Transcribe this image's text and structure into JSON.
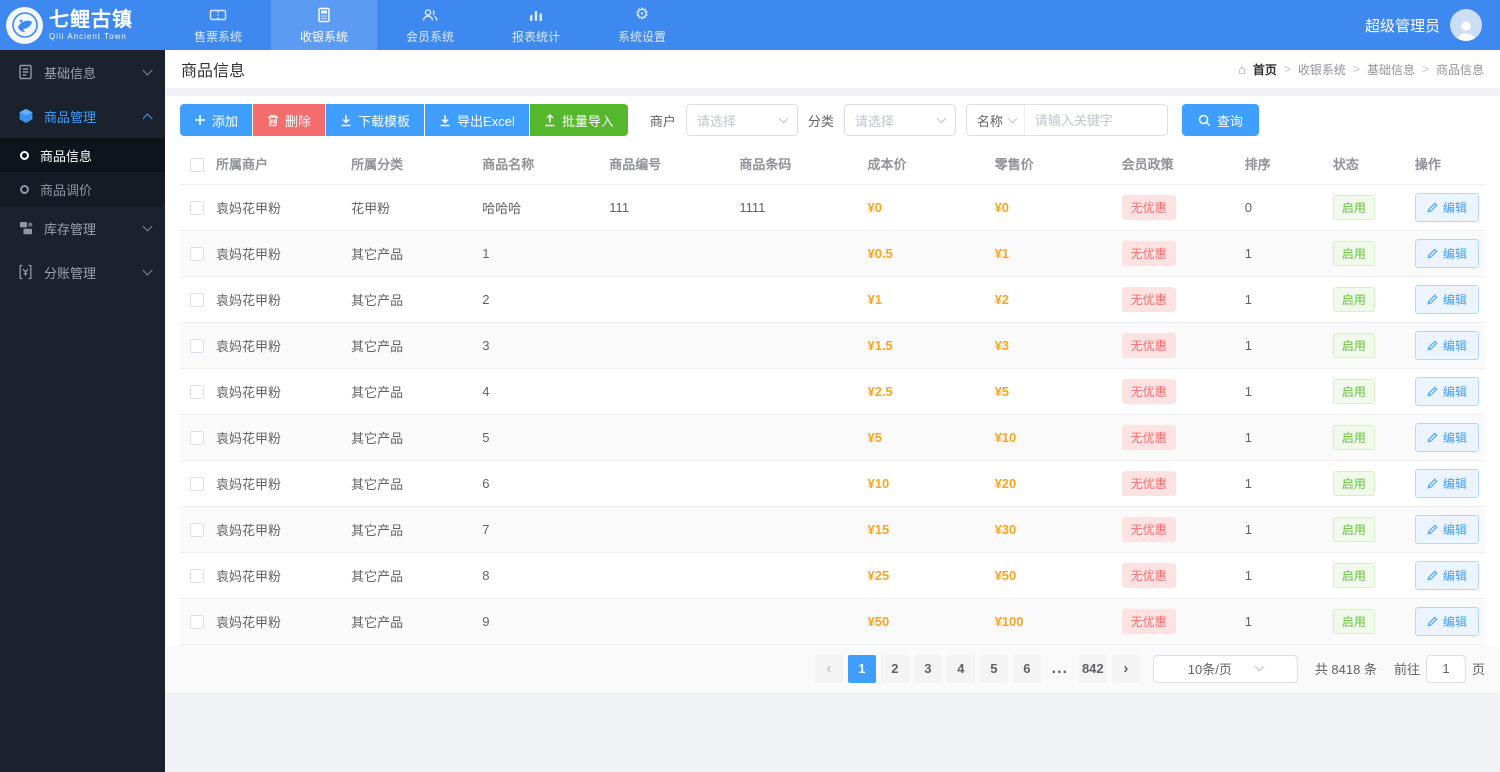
{
  "header": {
    "logo": {
      "title": "七鲤古镇",
      "subtitle": "Qili Ancient Town"
    },
    "nav": [
      {
        "label": "售票系统",
        "icon": "ticket-icon",
        "active": false
      },
      {
        "label": "收银系统",
        "icon": "pos-icon",
        "active": true
      },
      {
        "label": "会员系统",
        "icon": "members-icon",
        "active": false
      },
      {
        "label": "报表统计",
        "icon": "report-chart-icon",
        "active": false
      },
      {
        "label": "系统设置",
        "icon": "gear-icon",
        "active": false
      }
    ],
    "user": {
      "name": "超级管理员"
    }
  },
  "sidebar": {
    "items": [
      {
        "label": "基础信息",
        "icon": "document-icon"
      },
      {
        "label": "商品管理",
        "icon": "cube-icon",
        "expanded": true,
        "children": [
          {
            "label": "商品信息",
            "active": true
          },
          {
            "label": "商品调价",
            "active": false
          }
        ]
      },
      {
        "label": "库存管理",
        "icon": "inventory-icon"
      },
      {
        "label": "分账管理",
        "icon": "ledger-icon"
      }
    ]
  },
  "page": {
    "title": "商品信息",
    "breadcrumb": {
      "home": "首页",
      "sep": ">",
      "crumb1": "收银系统",
      "crumb2": "基础信息",
      "crumb3": "商品信息"
    }
  },
  "toolbar": {
    "add_label": "添加",
    "delete_label": "删除",
    "download_template_label": "下载模板",
    "export_excel_label": "导出Excel",
    "batch_import_label": "批量导入"
  },
  "filters": {
    "merchant_label": "商户",
    "merchant_placeholder": "请选择",
    "category_label": "分类",
    "category_placeholder": "请选择",
    "name_field_label": "名称",
    "keyword_placeholder": "请输入关键字",
    "search_label": "查询"
  },
  "table": {
    "columns": [
      "所属商户",
      "所属分类",
      "商品名称",
      "商品编号",
      "商品条码",
      "成本价",
      "零售价",
      "会员政策",
      "排序",
      "状态",
      "操作"
    ],
    "rows": [
      {
        "merchant": "袁妈花甲粉",
        "category": "花甲粉",
        "name": "哈哈哈",
        "code": "111",
        "barcode": "1111",
        "cost": "¥0",
        "price": "¥0",
        "policy": "无优惠",
        "sort": "0",
        "status": "启用",
        "action": "编辑"
      },
      {
        "merchant": "袁妈花甲粉",
        "category": "其它产品",
        "name": "1",
        "code": "",
        "barcode": "",
        "cost": "¥0.5",
        "price": "¥1",
        "policy": "无优惠",
        "sort": "1",
        "status": "启用",
        "action": "编辑"
      },
      {
        "merchant": "袁妈花甲粉",
        "category": "其它产品",
        "name": "2",
        "code": "",
        "barcode": "",
        "cost": "¥1",
        "price": "¥2",
        "policy": "无优惠",
        "sort": "1",
        "status": "启用",
        "action": "编辑"
      },
      {
        "merchant": "袁妈花甲粉",
        "category": "其它产品",
        "name": "3",
        "code": "",
        "barcode": "",
        "cost": "¥1.5",
        "price": "¥3",
        "policy": "无优惠",
        "sort": "1",
        "status": "启用",
        "action": "编辑"
      },
      {
        "merchant": "袁妈花甲粉",
        "category": "其它产品",
        "name": "4",
        "code": "",
        "barcode": "",
        "cost": "¥2.5",
        "price": "¥5",
        "policy": "无优惠",
        "sort": "1",
        "status": "启用",
        "action": "编辑"
      },
      {
        "merchant": "袁妈花甲粉",
        "category": "其它产品",
        "name": "5",
        "code": "",
        "barcode": "",
        "cost": "¥5",
        "price": "¥10",
        "policy": "无优惠",
        "sort": "1",
        "status": "启用",
        "action": "编辑"
      },
      {
        "merchant": "袁妈花甲粉",
        "category": "其它产品",
        "name": "6",
        "code": "",
        "barcode": "",
        "cost": "¥10",
        "price": "¥20",
        "policy": "无优惠",
        "sort": "1",
        "status": "启用",
        "action": "编辑"
      },
      {
        "merchant": "袁妈花甲粉",
        "category": "其它产品",
        "name": "7",
        "code": "",
        "barcode": "",
        "cost": "¥15",
        "price": "¥30",
        "policy": "无优惠",
        "sort": "1",
        "status": "启用",
        "action": "编辑"
      },
      {
        "merchant": "袁妈花甲粉",
        "category": "其它产品",
        "name": "8",
        "code": "",
        "barcode": "",
        "cost": "¥25",
        "price": "¥50",
        "policy": "无优惠",
        "sort": "1",
        "status": "启用",
        "action": "编辑"
      },
      {
        "merchant": "袁妈花甲粉",
        "category": "其它产品",
        "name": "9",
        "code": "",
        "barcode": "",
        "cost": "¥50",
        "price": "¥100",
        "policy": "无优惠",
        "sort": "1",
        "status": "启用",
        "action": "编辑"
      }
    ]
  },
  "pagination": {
    "prev": "‹",
    "pages": [
      "1",
      "2",
      "3",
      "4",
      "5",
      "6"
    ],
    "active_page": "1",
    "ellipsis": "...",
    "last_page": "842",
    "next": "›",
    "page_size": "10条/页",
    "total": "共 8418 条",
    "goto_label": "前往",
    "goto_value": "1",
    "goto_suffix": "页"
  },
  "colors": {
    "header_blue": "#3d89f0",
    "accent_blue": "#409eff",
    "danger_red": "#f56c6c",
    "success_green": "#55b72b",
    "price_orange": "#f5a623",
    "sidebar_dark": "#1a222d"
  }
}
